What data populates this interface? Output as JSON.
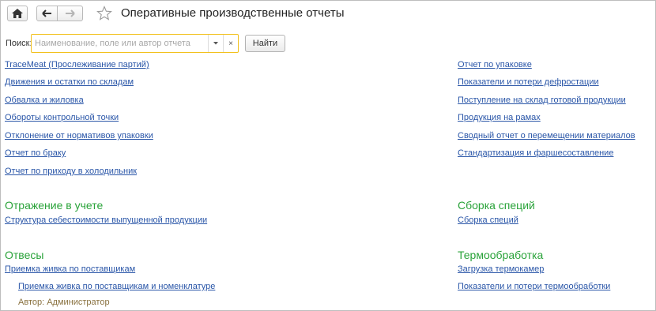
{
  "header": {
    "title": "Оперативные производственные отчеты",
    "icons": {
      "home": "home-icon",
      "back": "arrow-left-icon",
      "forward": "arrow-right-icon",
      "favorite": "star-icon"
    }
  },
  "search": {
    "label": "Поиск:",
    "placeholder": "Наименование, поле или автор отчета",
    "value": "",
    "clear": "×",
    "find_label": "Найти"
  },
  "left_links": [
    "TraceMeat (Прослеживание партий)",
    "Движения и остатки по складам",
    "Обвалка и жиловка",
    "Обороты контрольной точки",
    "Отклонение от нормативов упаковки",
    "Отчет по браку",
    "Отчет по приходу в холодильник"
  ],
  "right_links": [
    "Отчет по упаковке",
    "Показатели и потери дефростации",
    "Поступление на склад готовой продукции",
    "Продукция на рамах",
    "Сводный отчет о перемещении материалов",
    "Стандартизация и фаршесоставление"
  ],
  "sections": {
    "accounting": {
      "title": "Отражение в учете",
      "links": [
        "Структура себестоимости выпущенной продукции"
      ]
    },
    "specs": {
      "title": "Сборка специй",
      "links": [
        "Сборка специй"
      ]
    },
    "weights": {
      "title": "Отвесы",
      "links": [
        "Приемка живка по поставщикам",
        "Приемка живка по поставщикам и номенклатуре"
      ],
      "author": "Автор: Администратор"
    },
    "thermo": {
      "title": "Термообработка",
      "links": [
        "Загрузка термокамер",
        "Показатели и потери термообработки"
      ]
    }
  },
  "colors": {
    "link": "#2a56a8",
    "section": "#2aa33a",
    "focus_border": "#f2c11e",
    "author": "#8a7240"
  }
}
